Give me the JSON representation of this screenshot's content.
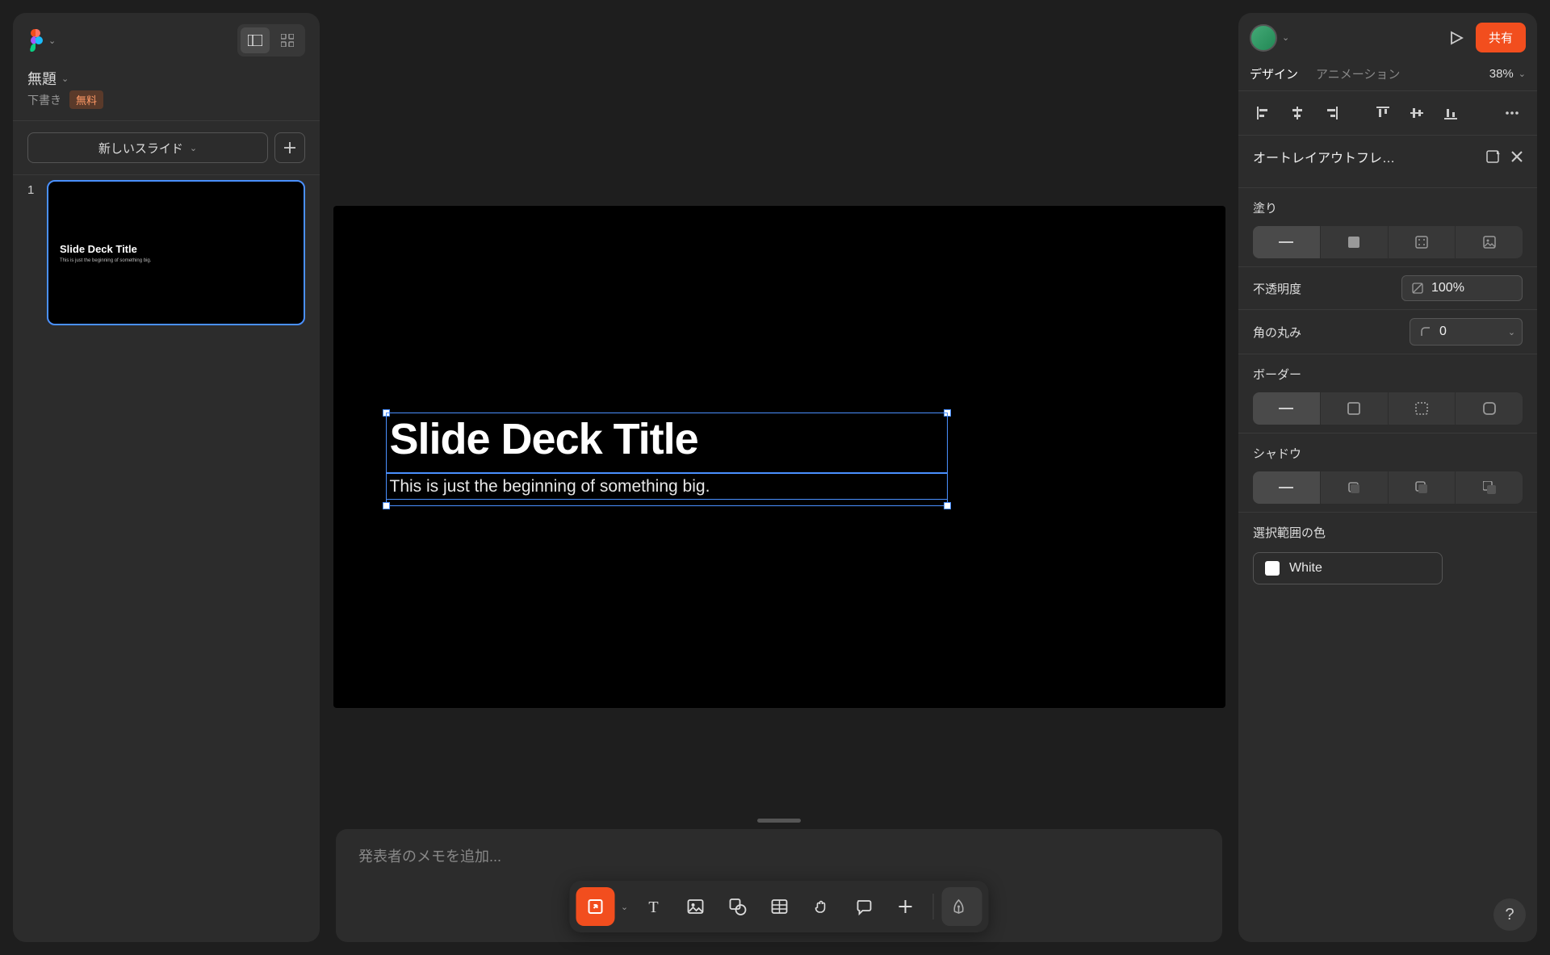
{
  "doc": {
    "title": "無題",
    "status": "下書き",
    "plan_badge": "無料"
  },
  "left": {
    "new_slide": "新しいスライド",
    "slides": [
      {
        "index": "1",
        "title": "Slide Deck Title",
        "subtitle": "This is just the beginning of something big."
      }
    ]
  },
  "slide": {
    "title": "Slide Deck Title",
    "subtitle": "This is just the beginning of something big."
  },
  "notes": {
    "placeholder": "発表者のメモを追加..."
  },
  "top_right": {
    "share": "共有",
    "zoom": "38%"
  },
  "tabs": {
    "design": "デザイン",
    "animation": "アニメーション"
  },
  "panel": {
    "autolayout": "オートレイアウトフレ…",
    "fill": "塗り",
    "opacity_label": "不透明度",
    "opacity_value": "100%",
    "corner_label": "角の丸み",
    "corner_value": "0",
    "border": "ボーダー",
    "shadow": "シャドウ",
    "selection_color": "選択範囲の色",
    "color_name": "White"
  },
  "help": "?"
}
